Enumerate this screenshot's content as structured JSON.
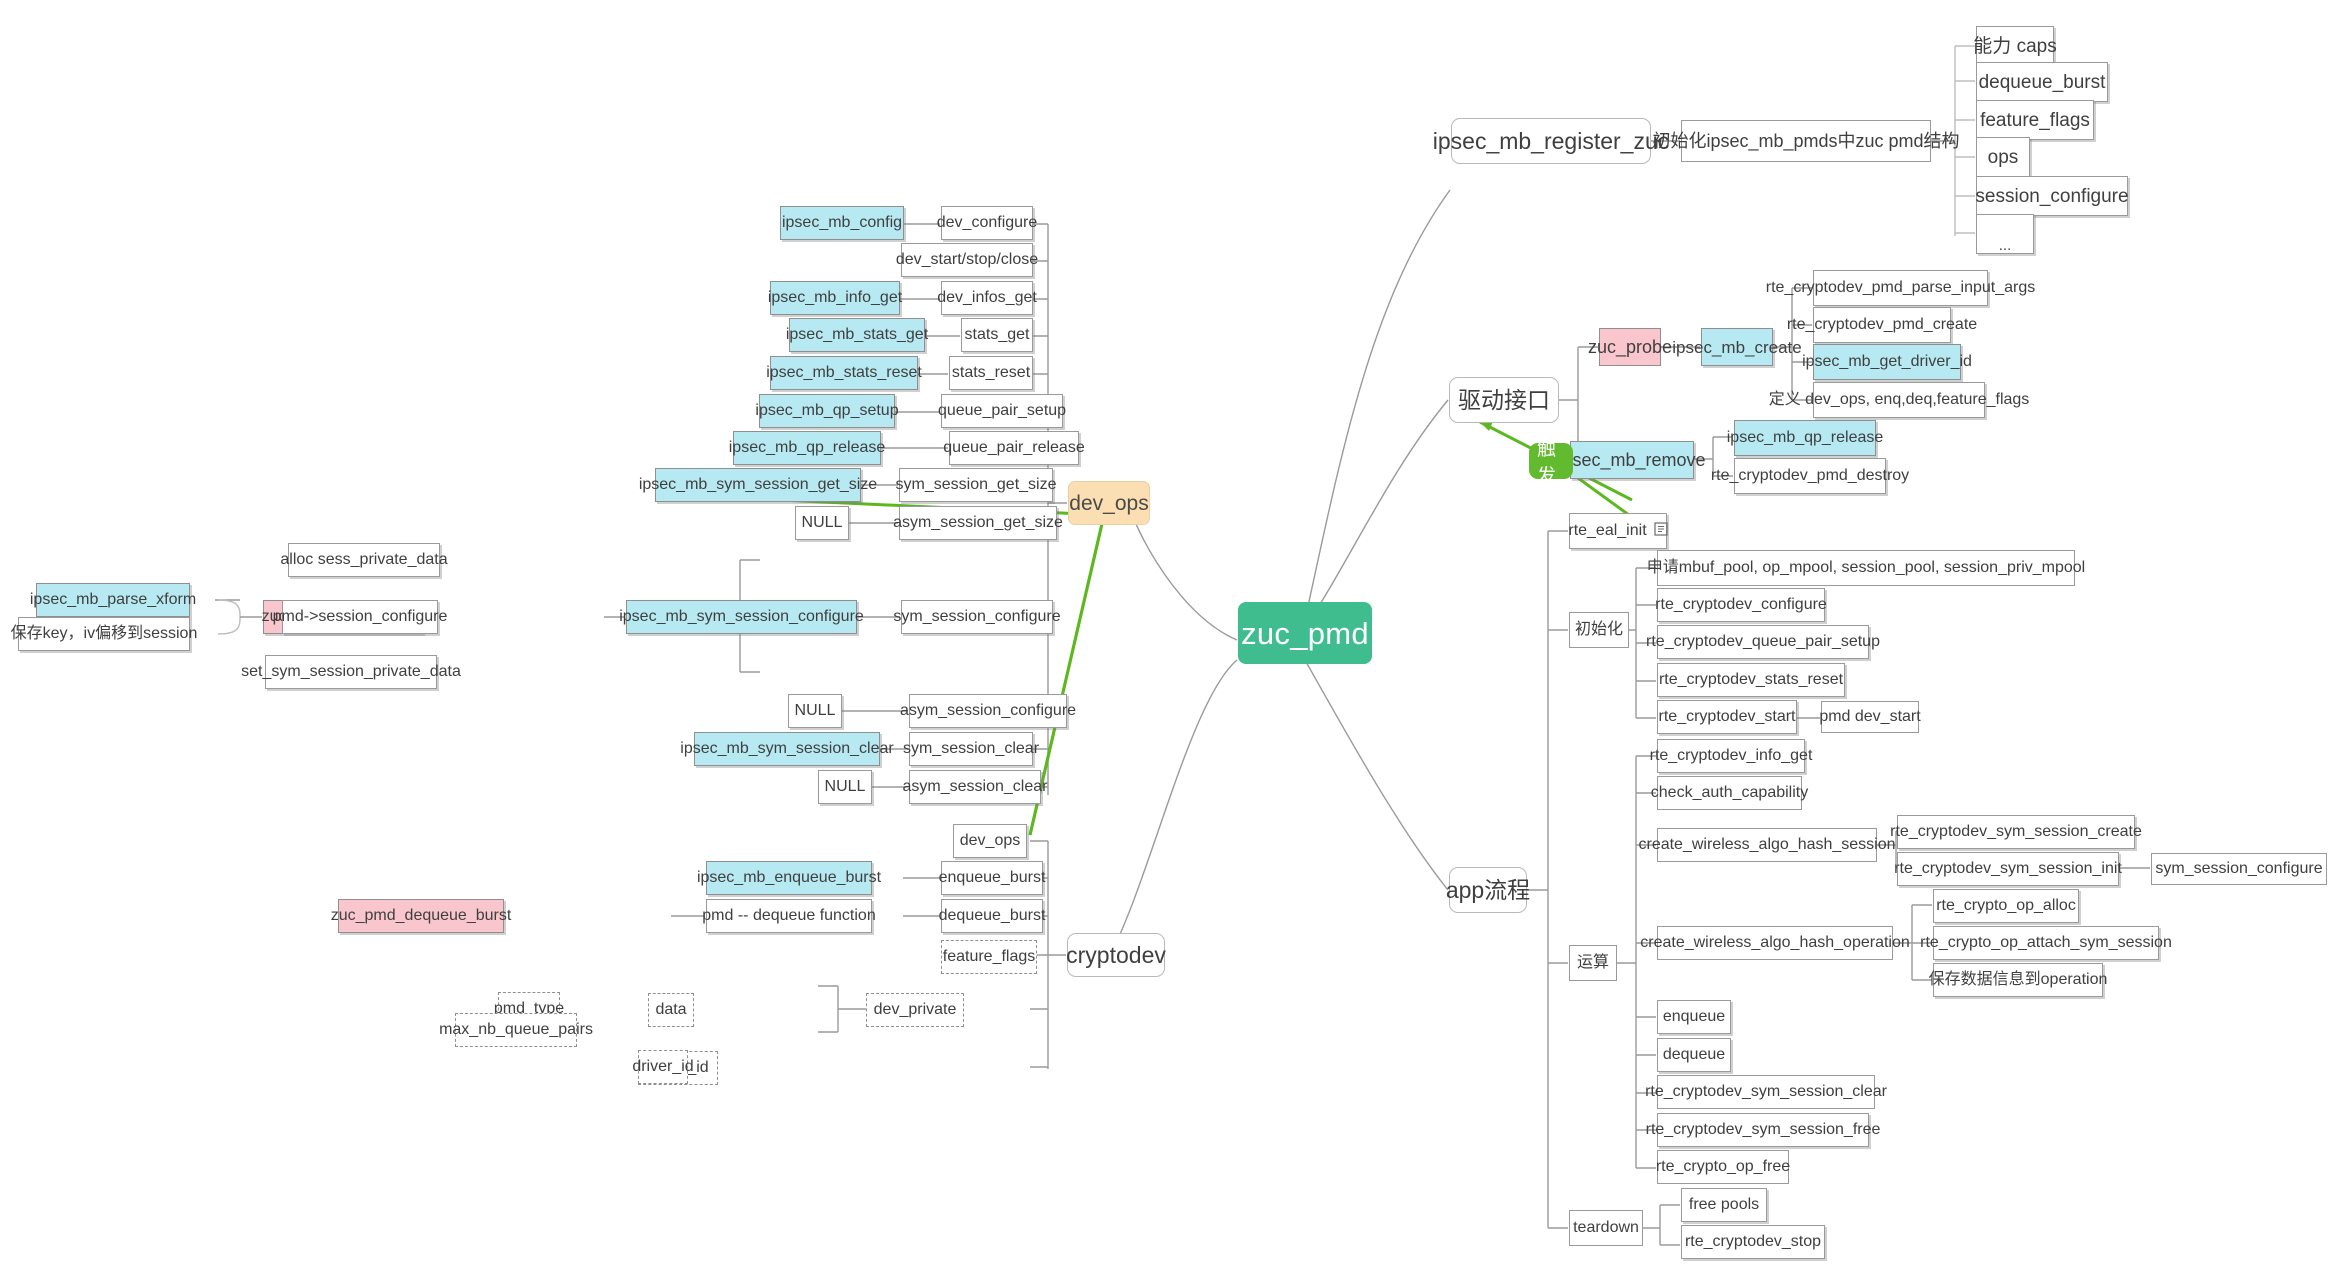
{
  "diagram": {
    "type": "mindmap",
    "title": "zuc_pmd",
    "root": {
      "label": "zuc_pmd",
      "color": "#3fbd8e"
    },
    "colors": {
      "root_green": "#3fbd8e",
      "highlight_cyan": "#b7e9f2",
      "highlight_pink": "#f9c6cd",
      "highlight_orange": "#fbdfb3",
      "badge_green": "#62bb2f",
      "box_border": "#9a9a9a",
      "text": "#3f3f3f",
      "link": "#9a9a9a",
      "arrow_green": "#5cb81f"
    },
    "branches": {
      "ipsec_mb_register_zuc": {
        "label": "ipsec_mb_register_zuc",
        "child": "初始化ipsec_mb_pmds中zuc pmd结构",
        "fields": [
          "能力 caps",
          "dequeue_burst",
          "feature_flags",
          "ops",
          "session_configure",
          "..."
        ]
      },
      "driver_interface": {
        "label": "驱动接口",
        "items": [
          {
            "label": "zuc_probe",
            "style": "pink",
            "child": {
              "label": "ipsec_mb_create",
              "style": "cyan",
              "children": [
                {
                  "label": "rte_cryptodev_pmd_parse_input_args",
                  "style": "plain"
                },
                {
                  "label": "rte_cryptodev_pmd_create",
                  "style": "plain"
                },
                {
                  "label": "ipsec_mb_get_driver_id",
                  "style": "cyan"
                },
                {
                  "label": "定义 dev_ops, enq,deq,feature_flags",
                  "style": "plain"
                }
              ]
            }
          },
          {
            "label": "ipsec_mb_remove",
            "style": "cyan",
            "children": [
              {
                "label": "ipsec_mb_qp_release",
                "style": "cyan"
              },
              {
                "label": "rte_cryptodev_pmd_destroy",
                "style": "plain"
              }
            ]
          }
        ],
        "trigger_badge": "触发"
      },
      "app_flow": {
        "label": "app流程",
        "rte_eal_init": {
          "label": "rte_eal_init",
          "icon": "note-icon"
        },
        "groups": [
          {
            "label": "初始化",
            "items": [
              {
                "label": "申请mbuf_pool, op_mpool, session_pool, session_priv_mpool"
              },
              {
                "label": "rte_cryptodev_configure"
              },
              {
                "label": "rte_cryptodev_queue_pair_setup"
              },
              {
                "label": "rte_cryptodev_stats_reset"
              },
              {
                "label": "rte_cryptodev_start",
                "child": "pmd  dev_start"
              }
            ]
          },
          {
            "label": "运算",
            "items": [
              {
                "label": "rte_cryptodev_info_get"
              },
              {
                "label": "check_auth_capability"
              },
              {
                "label": "create_wireless_algo_hash_session",
                "children": [
                  {
                    "label": "rte_cryptodev_sym_session_create"
                  },
                  {
                    "label": "rte_cryptodev_sym_session_init",
                    "child": "sym_session_configure"
                  }
                ]
              },
              {
                "label": "create_wireless_algo_hash_operation",
                "children": [
                  {
                    "label": "rte_crypto_op_alloc"
                  },
                  {
                    "label": "rte_crypto_op_attach_sym_session"
                  },
                  {
                    "label": "保存数据信息到operation"
                  }
                ]
              },
              {
                "label": "enqueue"
              },
              {
                "label": "dequeue"
              },
              {
                "label": "rte_cryptodev_sym_session_clear"
              },
              {
                "label": "rte_cryptodev_sym_session_free"
              },
              {
                "label": "rte_crypto_op_free"
              }
            ]
          },
          {
            "label": "teardown",
            "items": [
              {
                "label": "free pools"
              },
              {
                "label": "rte_cryptodev_stop"
              }
            ]
          }
        ]
      },
      "dev_ops": {
        "label": "dev_ops",
        "rows": [
          {
            "impl": "ipsec_mb_config",
            "impl_style": "cyan",
            "op": "dev_configure"
          },
          {
            "impl": null,
            "op": "dev_start/stop/close"
          },
          {
            "impl": "ipsec_mb_info_get",
            "impl_style": "cyan",
            "op": "dev_infos_get"
          },
          {
            "impl": "ipsec_mb_stats_get",
            "impl_style": "cyan",
            "op": "stats_get"
          },
          {
            "impl": "ipsec_mb_stats_reset",
            "impl_style": "cyan",
            "op": "stats_reset"
          },
          {
            "impl": "ipsec_mb_qp_setup",
            "impl_style": "cyan",
            "op": "queue_pair_setup"
          },
          {
            "impl": "ipsec_mb_qp_release",
            "impl_style": "cyan",
            "op": "queue_pair_release"
          },
          {
            "impl": "ipsec_mb_sym_session_get_size",
            "impl_style": "cyan",
            "op": "sym_session_get_size"
          },
          {
            "impl": "NULL",
            "impl_style": "plain",
            "op": "asym_session_get_size"
          },
          {
            "impl": "ipsec_mb_sym_session_configure",
            "impl_style": "cyan",
            "op": "sym_session_configure"
          },
          {
            "impl": "NULL",
            "impl_style": "plain",
            "op": "asym_session_configure"
          },
          {
            "impl": "ipsec_mb_sym_session_clear",
            "impl_style": "cyan",
            "op": "sym_session_clear"
          },
          {
            "impl": "NULL",
            "impl_style": "plain",
            "op": "asym_session_clear"
          }
        ],
        "session_configure_chain": {
          "left_leaves": [
            {
              "label": "ipsec_mb_parse_xform",
              "style": "cyan"
            },
            {
              "label": "保存key，iv偏移到session",
              "style": "plain"
            }
          ],
          "middle": {
            "label": "zuc_session_configure",
            "style": "pink"
          },
          "right_leaves": [
            {
              "label": "alloc sess_private_data"
            },
            {
              "label": "pmd->session_configure"
            },
            {
              "label": "set_sym_session_private_data"
            }
          ]
        }
      },
      "cryptodev": {
        "label": "cryptodev",
        "fields": [
          {
            "label": "dev_ops",
            "style": "plain"
          },
          {
            "label": "enqueue_burst",
            "style": "plain"
          },
          {
            "label": "dequeue_burst",
            "style": "plain"
          },
          {
            "label": "feature_flags",
            "style": "dashed"
          },
          {
            "label": "dev_private",
            "style": "dashed"
          },
          {
            "label": "driver_id",
            "style": "dashed"
          }
        ],
        "burst_chain": {
          "impl": {
            "label": "zuc_pmd_dequeue_burst",
            "style": "pink"
          },
          "note": {
            "label": "pmd -- dequeue function",
            "style": "plain"
          },
          "enqueue_impl": {
            "label": "ipsec_mb_enqueue_burst",
            "style": "cyan"
          }
        },
        "dev_private_fields": [
          {
            "label": "pmd_type",
            "style": "dashed"
          },
          {
            "label": "max_nb_queue_pairs",
            "style": "dashed"
          },
          {
            "label": "data",
            "style": "dashed"
          },
          {
            "label": "driver_id",
            "style": "dashed"
          }
        ]
      }
    }
  }
}
